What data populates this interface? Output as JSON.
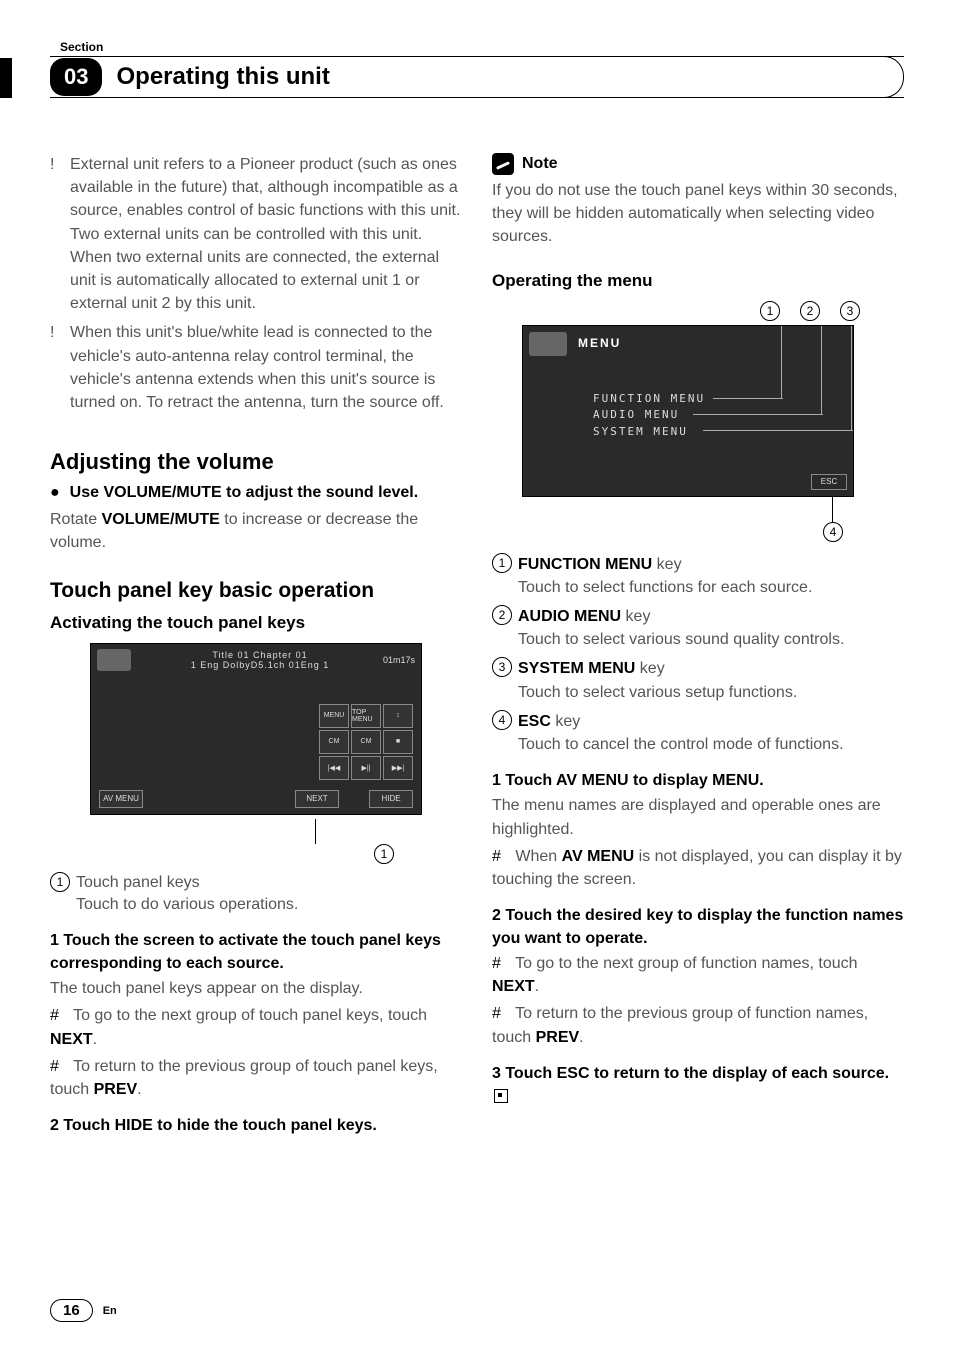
{
  "header": {
    "section_label": "Section",
    "chapter_number": "03",
    "chapter_title": "Operating this unit"
  },
  "left": {
    "bullets": [
      "External unit refers to a Pioneer product (such as ones available in the future) that, although incompatible as a source, enables control of basic functions with this unit. Two external units can be controlled with this unit. When two external units are connected, the external unit is automatically allocated to external unit 1 or external unit 2 by this unit.",
      "When this unit's blue/white lead is connected to the vehicle's auto-antenna relay control terminal, the vehicle's antenna extends when this unit's source is turned on. To retract the antenna, turn the source off."
    ],
    "adjust_heading": "Adjusting the volume",
    "adjust_lead_pre": "Use ",
    "adjust_lead_bold": "VOLUME/MUTE",
    "adjust_lead_post": " to adjust the sound level.",
    "adjust_body_pre": "Rotate ",
    "adjust_body_bold": "VOLUME/MUTE",
    "adjust_body_post": " to increase or decrease the volume.",
    "touch_heading": "Touch panel key basic operation",
    "activating_heading": "Activating the touch panel keys",
    "screenshot1": {
      "top_center": "Title 01   Chapter  01",
      "top_sub": "1   Eng  DolbyD5.1ch  01Eng   1",
      "time": "01m17s",
      "grid": [
        "MENU",
        "TOP MENU",
        "↕",
        "CM",
        "CM",
        "■",
        "|◀◀",
        "▶||",
        "▶▶|"
      ],
      "bottom_left": "AV MENU",
      "bottom_mid": "NEXT",
      "bottom_right": "HIDE"
    },
    "callout1_num": "1",
    "callout1_label": "Touch panel keys",
    "callout1_desc": "Touch to do various operations.",
    "step1": "1    Touch the screen to activate the touch panel keys corresponding to each source.",
    "step1_body": "The touch panel keys appear on the display.",
    "step1_b1_pre": "To go to the next group of touch panel keys, touch ",
    "step1_b1_bold": "NEXT",
    "step1_b1_post": ".",
    "step1_b2_pre": "To return to the previous group of touch panel keys, touch ",
    "step1_b2_bold": "PREV",
    "step1_b2_post": ".",
    "step2": "2    Touch HIDE to hide the touch panel keys."
  },
  "right": {
    "note_label": "Note",
    "note_body": "If you do not use the touch panel keys within 30 seconds, they will be hidden automatically when selecting video sources.",
    "op_menu_heading": "Operating the menu",
    "co_nums": [
      "1",
      "2",
      "3",
      "4"
    ],
    "screenshot2": {
      "menu_label": "MENU",
      "items": [
        "FUNCTION MENU",
        "AUDIO MENU",
        "SYSTEM MENU"
      ],
      "esc": "ESC"
    },
    "keys": [
      {
        "num": "1",
        "bold": "FUNCTION MENU",
        "tail": " key",
        "desc": "Touch to select functions for each source."
      },
      {
        "num": "2",
        "bold": "AUDIO MENU",
        "tail": " key",
        "desc": "Touch to select various sound quality controls."
      },
      {
        "num": "3",
        "bold": "SYSTEM MENU",
        "tail": " key",
        "desc": "Touch to select various setup functions."
      },
      {
        "num": "4",
        "bold": "ESC",
        "tail": " key",
        "desc": "Touch to cancel the control mode of functions."
      }
    ],
    "step1": "1    Touch AV MENU to display MENU.",
    "step1_body": "The menu names are displayed and operable ones are highlighted.",
    "step1_b1_pre": "When ",
    "step1_b1_bold": "AV MENU",
    "step1_b1_post": " is not displayed, you can display it by touching the screen.",
    "step2": "2    Touch the desired key to display the function names you want to operate.",
    "step2_b1_pre": "To go to the next group of function names, touch ",
    "step2_b1_bold": "NEXT",
    "step2_b1_post": ".",
    "step2_b2_pre": "To return to the previous group of function names, touch ",
    "step2_b2_bold": "PREV",
    "step2_b2_post": ".",
    "step3": "3    Touch ESC to return to the display of each source."
  },
  "footer": {
    "page": "16",
    "lang": "En"
  }
}
